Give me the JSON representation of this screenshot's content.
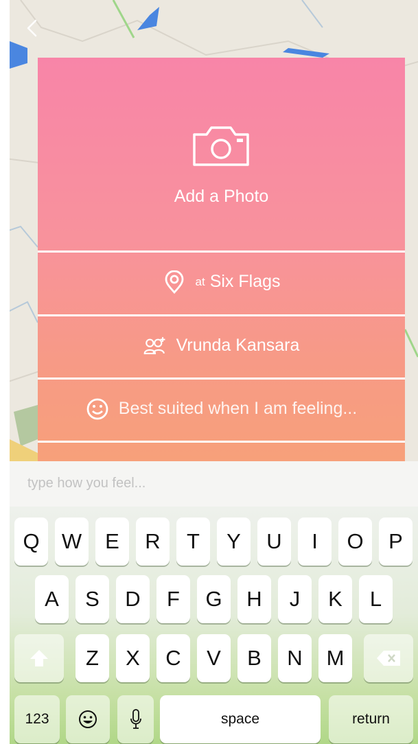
{
  "nav": {
    "back_icon": "chevron-left-icon"
  },
  "card": {
    "photo_icon": "camera-icon",
    "photo_label": "Add a Photo",
    "location": {
      "icon": "location-pin-icon",
      "prefix": "at",
      "name": "Six Flags"
    },
    "friend": {
      "icon": "add-friends-icon",
      "name": "Vrunda Kansara"
    },
    "feeling": {
      "icon": "smiley-icon",
      "placeholder": "Best suited when I am feeling..."
    }
  },
  "input": {
    "placeholder": "type how you feel...",
    "value": ""
  },
  "keyboard": {
    "row1": [
      "Q",
      "W",
      "E",
      "R",
      "T",
      "Y",
      "U",
      "I",
      "O",
      "P"
    ],
    "row2": [
      "A",
      "S",
      "D",
      "F",
      "G",
      "H",
      "J",
      "K",
      "L"
    ],
    "row3": [
      "Z",
      "X",
      "C",
      "V",
      "B",
      "N",
      "M"
    ],
    "numbers_label": "123",
    "space_label": "space",
    "return_label": "return",
    "shift_icon": "shift-arrow-icon",
    "delete_icon": "backspace-icon",
    "emoji_icon": "emoji-keyboard-icon",
    "mic_icon": "microphone-icon"
  },
  "colors": {
    "card_top": "#f885a8",
    "card_bottom": "#f7a07a",
    "divider": "#ffffff",
    "keyboard_green": "#b0d787"
  }
}
